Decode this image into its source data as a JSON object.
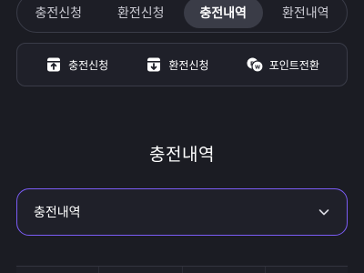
{
  "tabs": [
    {
      "label": "충전신청",
      "active": false
    },
    {
      "label": "환전신청",
      "active": false
    },
    {
      "label": "충전내역",
      "active": true
    },
    {
      "label": "환전내역",
      "active": false
    }
  ],
  "actions": [
    {
      "label": "충전신청",
      "icon": "deposit-card-icon"
    },
    {
      "label": "환전신청",
      "icon": "withdraw-card-icon"
    },
    {
      "label": "포인트전환",
      "icon": "point-convert-icon"
    }
  ],
  "section": {
    "title": "충전내역"
  },
  "dropdown": {
    "selected": "충전내역"
  },
  "colors": {
    "background": "#1b1c23",
    "active_tab": "#3a3c47",
    "dropdown_border": "#7b5cf5"
  }
}
